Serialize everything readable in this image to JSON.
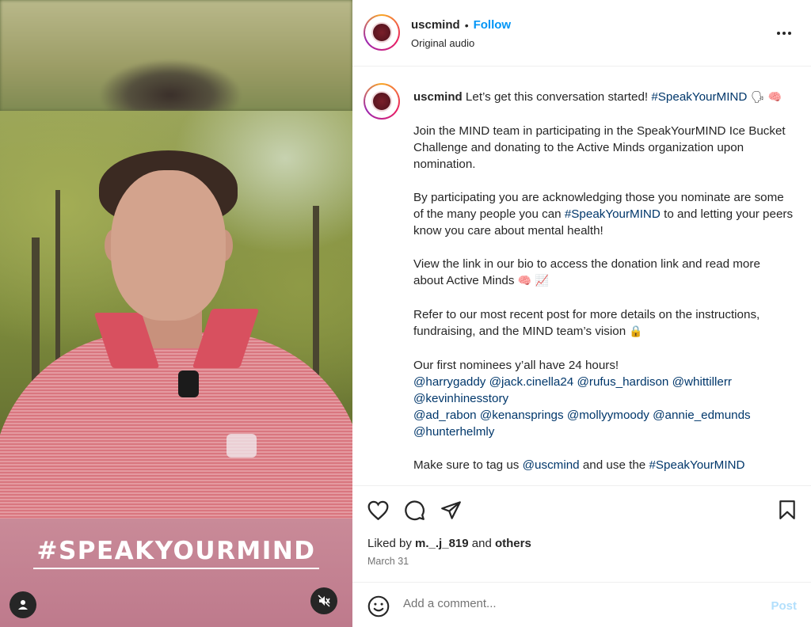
{
  "media": {
    "overlay_text": "#SPEAKYOURMIND",
    "user_tag_icon": "person-icon",
    "mute_icon": "speaker-muted-icon"
  },
  "header": {
    "username": "uscmind",
    "separator": "•",
    "follow_label": "Follow",
    "audio_label": "Original audio",
    "more_icon": "ellipsis-icon"
  },
  "caption": {
    "username": "uscmind",
    "intro": "Let’s get this conversation started!",
    "intro_hashtag": "#SpeakYourMIND",
    "intro_emojis": "🗣 🧠",
    "para1": "Join the MIND team in participating in the SpeakYourMIND Ice Bucket Challenge and donating to the Active Minds organization upon nomination.",
    "para2_a": "By participating you are acknowledging those you nominate are some of the many people you can",
    "para2_hashtag": "#SpeakYourMIND",
    "para2_b": "to and letting your peers know you care about mental health!",
    "para3": "View the link in our bio to access the donation link and read more about Active Minds",
    "para3_emojis": "🧠 📈",
    "para4": "Refer to our most recent post for more details on the instructions, fundraising, and the MIND team’s vision",
    "para4_emoji": "🔒",
    "para5": "Our first nominees y’all have 24 hours!",
    "nominees_line1": [
      "@harrygaddy",
      "@jack.cinella24",
      "@rufus_hardison",
      "@whittillerr"
    ],
    "nominees_line2": [
      "@kevinhinesstory"
    ],
    "nominees_line3": [
      "@ad_rabon",
      "@kenansprings",
      "@mollyymoody",
      "@annie_edmunds"
    ],
    "nominees_line4": [
      "@hunterhelmly"
    ],
    "para6_a": "Make sure to tag us",
    "para6_mention": "@uscmind",
    "para6_b": "and use the",
    "para6_hashtag": "#SpeakYourMIND"
  },
  "actions": {
    "like_icon": "heart-icon",
    "comment_icon": "comment-icon",
    "share_icon": "share-icon",
    "save_icon": "bookmark-icon"
  },
  "likes": {
    "prefix": "Liked by",
    "user": "m._.j_819",
    "and": "and",
    "others": "others"
  },
  "date": "March 31",
  "comment": {
    "placeholder": "Add a comment...",
    "post_label": "Post",
    "emoji_icon": "smiley-icon"
  },
  "colors": {
    "accent": "#0095f6",
    "link": "#00376b",
    "post_disabled": "#b2dffc",
    "overlay_band": "#c98a98"
  }
}
